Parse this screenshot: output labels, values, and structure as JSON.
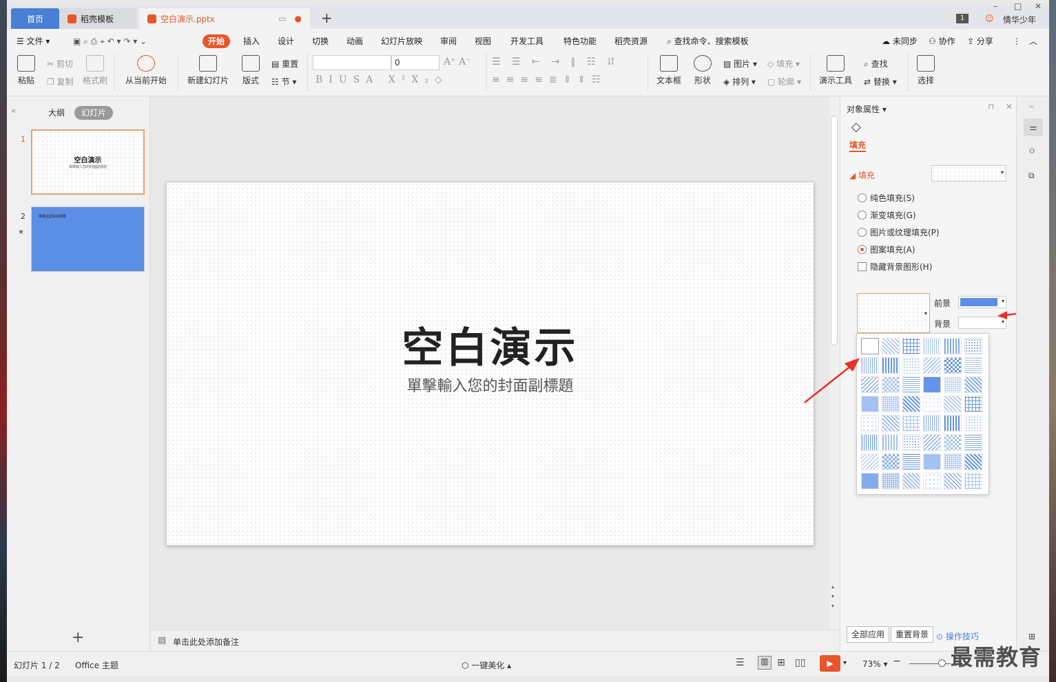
{
  "tabs": {
    "home": "首页",
    "daoke": "稻壳模板",
    "file": "空白演示.pptx",
    "win_count": "1",
    "user": "情华少年"
  },
  "menu": {
    "file": "文件",
    "items": [
      "开始",
      "插入",
      "设计",
      "切换",
      "动画",
      "幻灯片放映",
      "审阅",
      "视图",
      "开发工具",
      "特色功能",
      "稻壳资源"
    ],
    "search": "查找命令、搜索模板",
    "sync": "未同步",
    "collab": "协作",
    "share": "分享"
  },
  "ribbon": {
    "paste": "粘贴",
    "cut": "剪切",
    "copy": "复制",
    "format_painter": "格式刷",
    "from_current": "从当前开始",
    "new_slide": "新建幻灯片",
    "layout": "版式",
    "reset": "重置",
    "section": "节",
    "font_size": "0",
    "textbox": "文本框",
    "shape": "形状",
    "picture": "图片",
    "fill": "填充",
    "arrange": "排列",
    "outline": "轮廓",
    "present_tools": "演示工具",
    "find": "查找",
    "replace": "替换",
    "select": "选择"
  },
  "left": {
    "outline": "大纲",
    "slides": "幻灯片",
    "slide1_title": "空白演示",
    "slide1_sub": "單擊輸入您的封面副標題",
    "slide2_title": "單擊此處添加標題",
    "n1": "1",
    "n2": "2"
  },
  "slide": {
    "title": "空白演示",
    "subtitle": "單擊輸入您的封面副標題"
  },
  "notes": "单击此处添加备注",
  "props": {
    "title": "对象属性",
    "tab": "填充",
    "section": "填充",
    "solid": "纯色填充(S)",
    "gradient": "渐变填充(G)",
    "picture": "图片或纹理填充(P)",
    "pattern": "图案填充(A)",
    "hide_bg": "隐藏背景图形(H)",
    "fore": "前景",
    "back": "背景",
    "apply_all": "全部应用",
    "reset_bg": "重置背景",
    "tips": "操作技巧"
  },
  "status": {
    "slide": "幻灯片 1 / 2",
    "theme": "Office 主题",
    "beautify": "一键美化",
    "zoom": "73%"
  },
  "watermark": "最需教育",
  "colors": {
    "accent": "#e8562a",
    "fore": "#5b8fe6",
    "pattern": "#5b8fe6"
  }
}
